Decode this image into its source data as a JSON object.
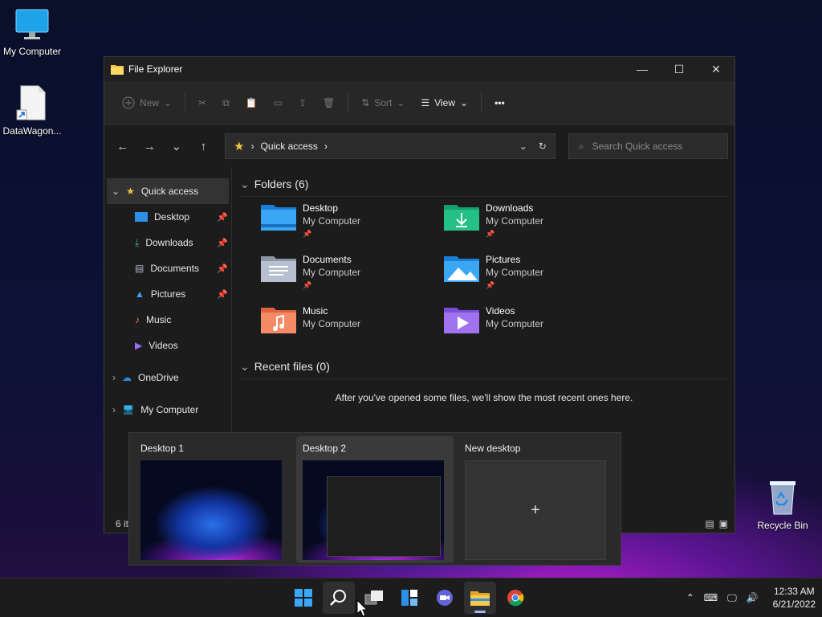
{
  "desktop": {
    "icons": [
      {
        "label": "My Computer"
      },
      {
        "label": "DataWagon..."
      },
      {
        "label": "Recycle Bin"
      }
    ]
  },
  "explorer": {
    "title": "File Explorer",
    "window_controls": {
      "minimize": "—",
      "maximize": "☐",
      "close": "✕"
    },
    "commands": {
      "new": "New",
      "sort": "Sort",
      "view": "View",
      "more": "•••"
    },
    "address": {
      "location": "Quick access"
    },
    "search": {
      "placeholder": "Search Quick access"
    },
    "sidebar": {
      "quick_access": "Quick access",
      "items": [
        {
          "label": "Desktop",
          "pin": "📌"
        },
        {
          "label": "Downloads",
          "pin": "📌"
        },
        {
          "label": "Documents",
          "pin": "📌"
        },
        {
          "label": "Pictures",
          "pin": "📌"
        },
        {
          "label": "Music"
        },
        {
          "label": "Videos"
        }
      ],
      "onedrive": "OneDrive",
      "my_computer": "My Computer"
    },
    "folders_header": "Folders (6)",
    "folders": [
      {
        "name": "Desktop",
        "location": "My Computer",
        "pinned": "📌"
      },
      {
        "name": "Downloads",
        "location": "My Computer",
        "pinned": "📌"
      },
      {
        "name": "Documents",
        "location": "My Computer",
        "pinned": "📌"
      },
      {
        "name": "Pictures",
        "location": "My Computer",
        "pinned": "📌"
      },
      {
        "name": "Music",
        "location": "My Computer"
      },
      {
        "name": "Videos",
        "location": "My Computer"
      }
    ],
    "recent_header": "Recent files (0)",
    "recent_empty": "After you've opened some files, we'll show the most recent ones here.",
    "status": "6 it"
  },
  "taskview": {
    "desktops": [
      {
        "label": "Desktop 1"
      },
      {
        "label": "Desktop 2"
      },
      {
        "label": "New desktop"
      }
    ],
    "new_symbol": "+"
  },
  "taskbar": {
    "clock": {
      "time": "12:33 AM",
      "date": "6/21/2022"
    }
  },
  "colors": {
    "folder_yellow": "#f4c542",
    "accent_blue": "#4fa3f7",
    "taskbar_bg": "#1c1c1c"
  }
}
